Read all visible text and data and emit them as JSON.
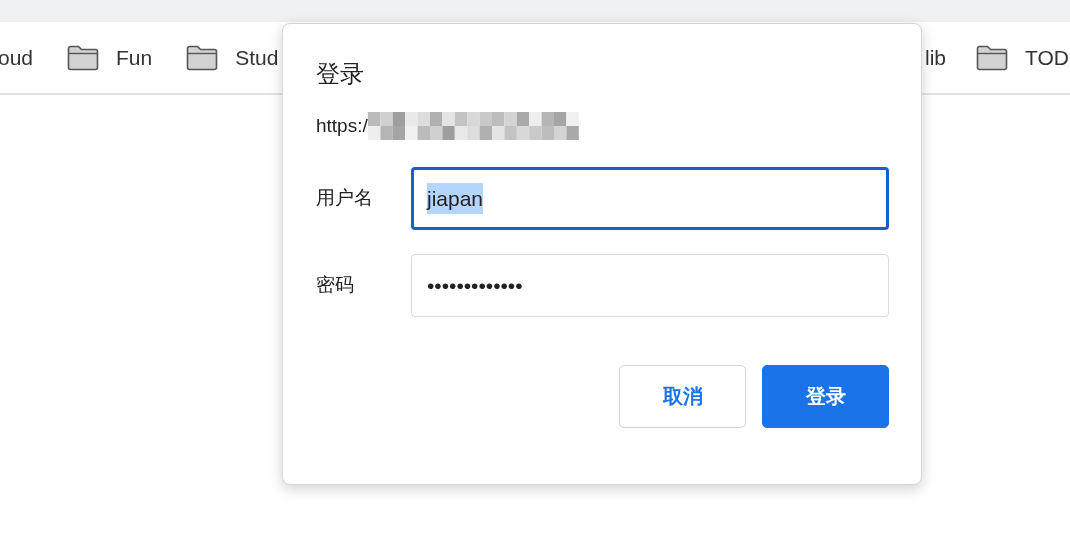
{
  "bookmarks_left": [
    {
      "label": "oud"
    },
    {
      "label": "Fun",
      "folder": true
    },
    {
      "label": "Stud",
      "folder": true
    }
  ],
  "bookmarks_right": [
    {
      "label": "lib"
    },
    {
      "label": "TOD",
      "folder": true
    }
  ],
  "dialog": {
    "title": "登录",
    "url": "https:/",
    "url_redacted": true,
    "fields": [
      {
        "label": "用户名",
        "value": "jiapan",
        "focused": true,
        "text_selected": true
      },
      {
        "label": "密码",
        "value": "•••••••••••••",
        "focused": false,
        "text_selected": false
      }
    ],
    "buttons": [
      {
        "label": "取消",
        "kind": "secondary"
      },
      {
        "label": "登录",
        "kind": "primary"
      }
    ]
  }
}
